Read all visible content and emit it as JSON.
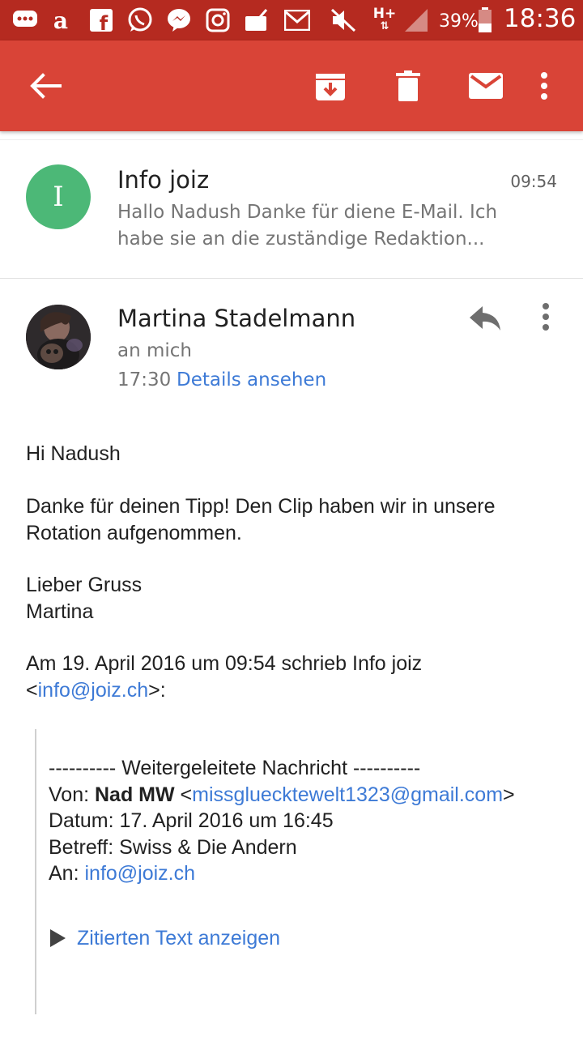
{
  "status_bar": {
    "battery": "39%",
    "time": "18:36",
    "network": "H+"
  },
  "app_bar": {
    "icons": [
      "back-arrow-icon",
      "archive-icon",
      "delete-icon",
      "mark-unread-icon",
      "more-vert-icon"
    ]
  },
  "thread": {
    "collapsed_message": {
      "avatar_letter": "I",
      "avatar_color": "#4cb877",
      "sender": "Info joiz",
      "time": "09:54",
      "snippet": "Hallo Nadush Danke für diene E-Mail. Ich habe sie an die zuständige Redaktion..."
    },
    "expanded_message": {
      "sender": "Martina Stadelmann",
      "to": "an mich",
      "time": "17:30",
      "details_link": "Details ansehen",
      "body": {
        "greeting": "Hi Nadush",
        "paragraph": "Danke für deinen Tipp! Den Clip haben wir in unsere Rotation aufgenommen.",
        "closing": "Lieber Gruss",
        "signature": "Martina",
        "quote_intro": "Am 19. April 2016 um 09:54 schrieb Info joiz",
        "quote_intro_lt": "<",
        "quote_intro_email": "info@joiz.ch",
        "quote_intro_gt": ">:"
      },
      "forwarded": {
        "separator": "---------- Weitergeleitete Nachricht ----------",
        "from_label": "Von: ",
        "from_name": "Nad MW",
        "from_lt": " <",
        "from_email": "missgluecktewelt1323@gmail.com",
        "from_gt": ">",
        "date_line": "Datum: 17. April 2016 um 16:45",
        "subject_line": "Betreff: Swiss & Die Andern",
        "to_label": "An: ",
        "to_email": "info@joiz.ch"
      },
      "show_quoted": "Zitierten Text anzeigen"
    }
  },
  "colors": {
    "status_bar": "#b52a20",
    "app_bar": "#d94437",
    "link": "#3d7ad6"
  }
}
